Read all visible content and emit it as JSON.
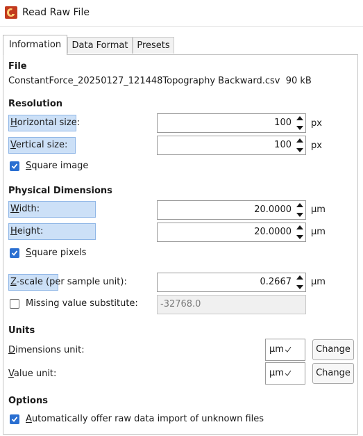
{
  "window": {
    "title": "Read Raw File"
  },
  "tabs": [
    {
      "label": "Information",
      "active": true
    },
    {
      "label": "Data Format",
      "active": false
    },
    {
      "label": "Presets",
      "active": false
    }
  ],
  "file": {
    "heading": "File",
    "name": "ConstantForce_20250127_121448Topography Backward.csv",
    "size": "90 kB"
  },
  "resolution": {
    "heading": "Resolution",
    "horizontal": {
      "label_key": "H",
      "label_rest": "orizontal size:",
      "value": "100",
      "unit": "px"
    },
    "vertical": {
      "label_key": "V",
      "label_rest": "ertical size:",
      "value": "100",
      "unit": "px"
    },
    "square_image": {
      "label_key": "S",
      "label_rest": "quare image",
      "checked": true
    }
  },
  "physical": {
    "heading": "Physical Dimensions",
    "width": {
      "label_key": "W",
      "label_rest": "idth:",
      "value": "20.0000",
      "unit": "µm"
    },
    "height": {
      "label_key": "H",
      "label_rest": "eight:",
      "value": "20.0000",
      "unit": "µm"
    },
    "square_pixels": {
      "label_key": "S",
      "label_rest": "quare pixels",
      "checked": true
    },
    "zscale": {
      "label_key": "Z",
      "label_rest": "-scale (per sample unit):",
      "value": "0.2667",
      "unit": "µm"
    },
    "missing": {
      "label": "Missing value substitute:",
      "value": "-32768.0",
      "checked": false
    }
  },
  "units": {
    "heading": "Units",
    "dimensions": {
      "label_key": "D",
      "label_rest": "imensions unit:",
      "value": "µm",
      "button": "Change"
    },
    "value": {
      "label_key": "V",
      "label_rest": "alue unit:",
      "value": "µm",
      "button": "Change"
    }
  },
  "options": {
    "heading": "Options",
    "auto_offer": {
      "label_key": "A",
      "label_rest": "utomatically offer raw data import of unknown files",
      "checked": true
    }
  },
  "colors": {
    "accent": "#2a6fd1",
    "highlight": "#cce0f7",
    "app_icon": "#c23a1e"
  }
}
